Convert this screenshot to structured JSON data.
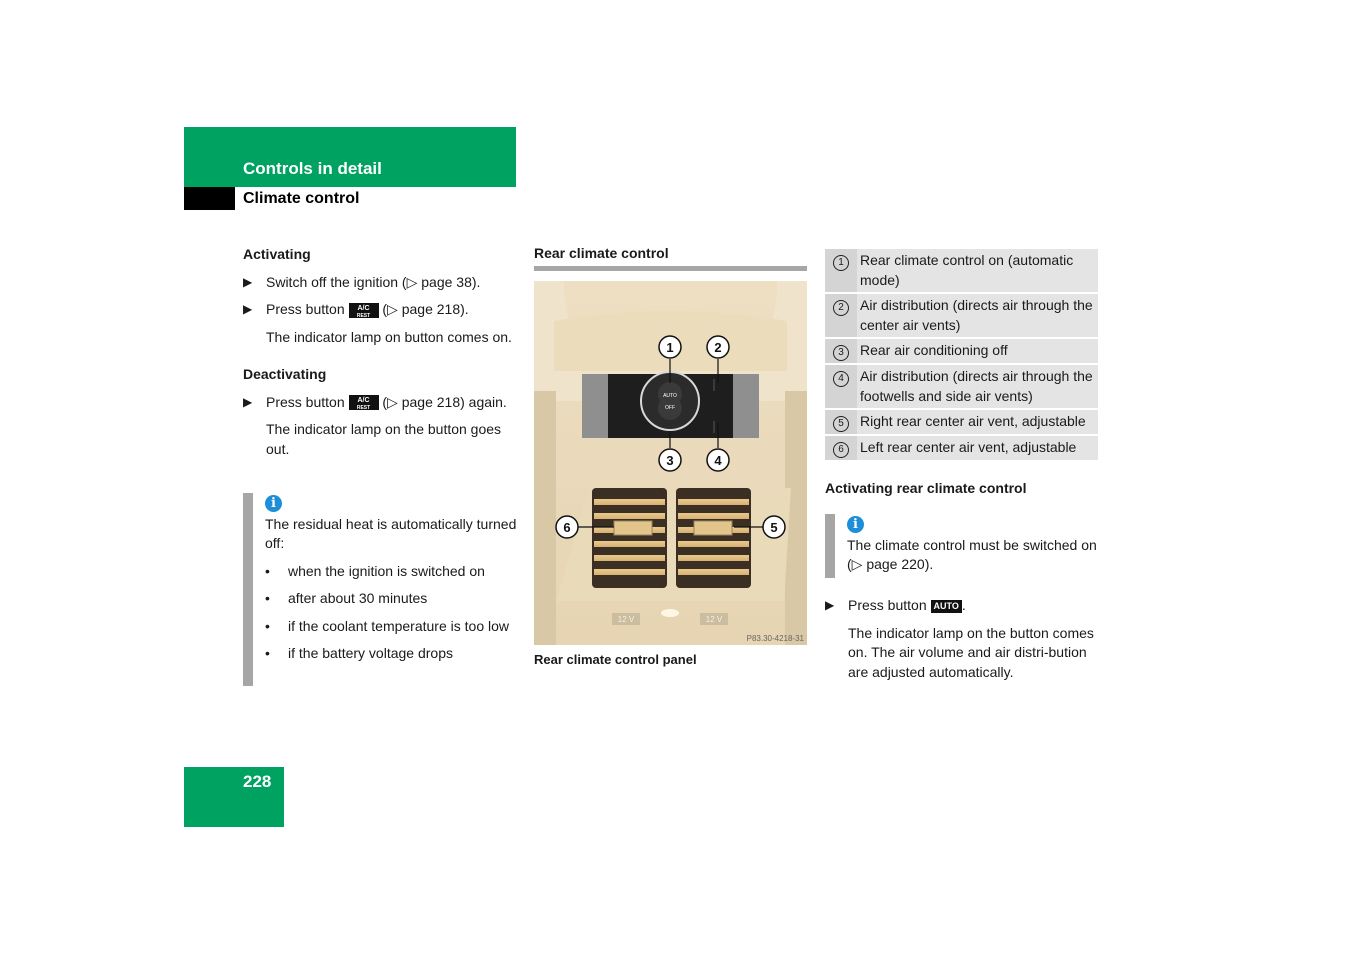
{
  "header": {
    "section": "Controls in detail",
    "subsection": "Climate control"
  },
  "page_number": "228",
  "left_column": {
    "activating": {
      "heading": "Activating",
      "steps": [
        {
          "text": "Switch off the ignition (▷ page 38)."
        },
        {
          "before": "Press button",
          "key": "A/C",
          "key_sub": "REST",
          "after": "(▷ page 218)."
        }
      ],
      "result": "The indicator lamp on button comes on."
    },
    "deactivating": {
      "heading": "Deactivating",
      "steps": [
        {
          "before": "Press button",
          "key": "A/C",
          "key_sub": "REST",
          "after": "(▷ page 218) again."
        }
      ],
      "result": "The indicator lamp on the button goes out."
    },
    "note": {
      "icon": "info-icon",
      "text": "The residual heat is automatically turned off:",
      "bullets": [
        "when the ignition is switched on",
        "after about 30 minutes",
        "if the coolant temperature is too low",
        "if the battery voltage drops"
      ]
    }
  },
  "middle_column": {
    "heading": "Rear climate control",
    "figure": {
      "panel_labels": {
        "auto": "AUTO",
        "off": "OFF",
        "socket_left": "12 V",
        "socket_right": "12 V"
      },
      "callouts": [
        "1",
        "2",
        "3",
        "4",
        "5",
        "6"
      ],
      "image_code": "P83.30-4218-31",
      "caption": "Rear climate control panel"
    }
  },
  "right_column": {
    "legend": [
      {
        "num": "1",
        "text": "Rear climate control on (automatic mode)"
      },
      {
        "num": "2",
        "text": "Air distribution (directs air through the center air vents)"
      },
      {
        "num": "3",
        "text": "Rear air conditioning off"
      },
      {
        "num": "4",
        "text": "Air distribution (directs air through the footwells and side air vents)"
      },
      {
        "num": "5",
        "text": "Right rear center air vent, adjustable"
      },
      {
        "num": "6",
        "text": "Left rear center air vent, adjustable"
      }
    ],
    "activating_rear": {
      "heading": "Activating rear climate control",
      "note": "The climate control must be switched on (▷ page 220).",
      "step_before": "Press button",
      "step_key": "AUTO",
      "step_after": ".",
      "result": "The indicator lamp on the button comes on. The air volume and air distri-bution are adjusted automatically."
    }
  },
  "colors": {
    "brand_green": "#00a261",
    "note_bar": "#a6a6a6",
    "info_blue": "#1c8fd8"
  }
}
